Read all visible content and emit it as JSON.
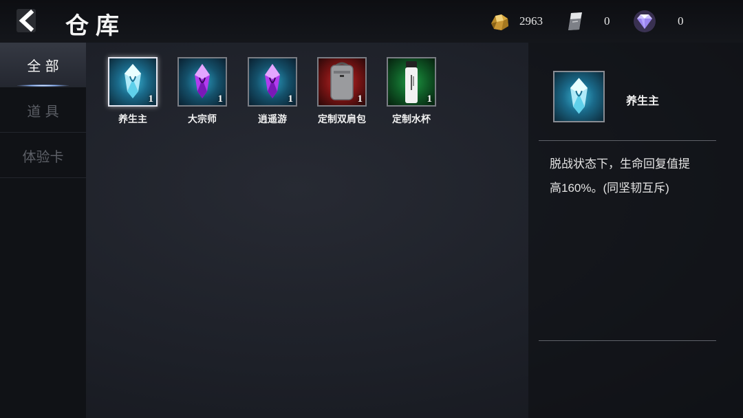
{
  "header": {
    "title": "仓库",
    "currencies": [
      {
        "icon": "gold-ore-icon",
        "value": "2963"
      },
      {
        "icon": "silver-ingot-icon",
        "value": "0"
      },
      {
        "icon": "diamond-icon",
        "value": "0"
      }
    ]
  },
  "sidebar": {
    "tabs": [
      {
        "label": "全 部",
        "active": true
      },
      {
        "label": "道 具",
        "active": false
      },
      {
        "label": "体验卡",
        "active": false
      }
    ]
  },
  "inventory": {
    "items": [
      {
        "name": "养生主",
        "count": "1",
        "icon": "blue-crystal-icon",
        "rarity_color": "#2fa6c4"
      },
      {
        "name": "大宗师",
        "count": "1",
        "icon": "purple-crystal-icon",
        "rarity_color": "#2c92b3"
      },
      {
        "name": "逍遥游",
        "count": "1",
        "icon": "purple-crystal-icon",
        "rarity_color": "#2c92b3"
      },
      {
        "name": "定制双肩包",
        "count": "1",
        "icon": "backpack-icon",
        "rarity_color": "#a11c1c"
      },
      {
        "name": "定制水杯",
        "count": "1",
        "icon": "water-bottle-icon",
        "rarity_color": "#1a8a3a"
      }
    ]
  },
  "detail": {
    "name": "养生主",
    "icon": "blue-crystal-icon",
    "description_line1": "脱战状态下，生命回复值提",
    "description_line2": "高160%。(同坚韧互斥)"
  },
  "colors": {
    "accent_glow": "#8fb8ff",
    "background": "#1d2028"
  }
}
